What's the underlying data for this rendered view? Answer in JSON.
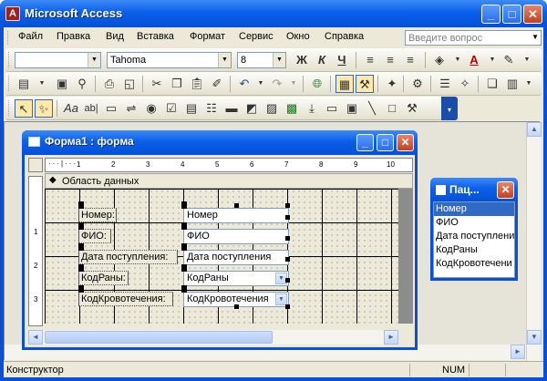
{
  "app": {
    "title": "Microsoft Access",
    "icon_letter": "A"
  },
  "window_buttons": {
    "minimize": "_",
    "maximize": "□",
    "close": "✕"
  },
  "menu": {
    "items": [
      "Файл",
      "Правка",
      "Вид",
      "Вставка",
      "Формат",
      "Сервис",
      "Окно",
      "Справка"
    ],
    "ask_placeholder": "Введите вопрос"
  },
  "formatting_toolbar": {
    "object_combo": "",
    "font_combo": "Tahoma",
    "size_combo": "8",
    "bold": "Ж",
    "italic": "К",
    "underline": "Ч"
  },
  "form_window": {
    "title": "Форма1 : форма",
    "section_label": "Область данных",
    "ruler_h": [
      "1",
      "2",
      "3",
      "4",
      "5",
      "6",
      "7",
      "8",
      "9",
      "10"
    ],
    "ruler_v": [
      "1",
      "2",
      "3"
    ],
    "rows": [
      {
        "label": "Номер:",
        "value": "Номер",
        "type": "text"
      },
      {
        "label": "ФИО:",
        "value": "ФИО",
        "type": "text"
      },
      {
        "label": "Дата поступления:",
        "value": "Дата поступления",
        "type": "text"
      },
      {
        "label": "КодРаны:",
        "value": "КодРаны",
        "type": "combo"
      },
      {
        "label": "КодКровотечения:",
        "value": "КодКровотечения",
        "type": "combo"
      }
    ]
  },
  "field_list": {
    "title": "Пац...",
    "items": [
      "Номер",
      "ФИО",
      "Дата поступлени",
      "КодРаны",
      "КодКровотечени"
    ],
    "selected": "Номер"
  },
  "status": {
    "left": "Конструктор",
    "num": "NUM"
  },
  "colors": {
    "titlebar": "#0a5fe8",
    "close": "#c4401e",
    "selection": "#316ac5",
    "toolbar_bg": "#ece9d8"
  }
}
